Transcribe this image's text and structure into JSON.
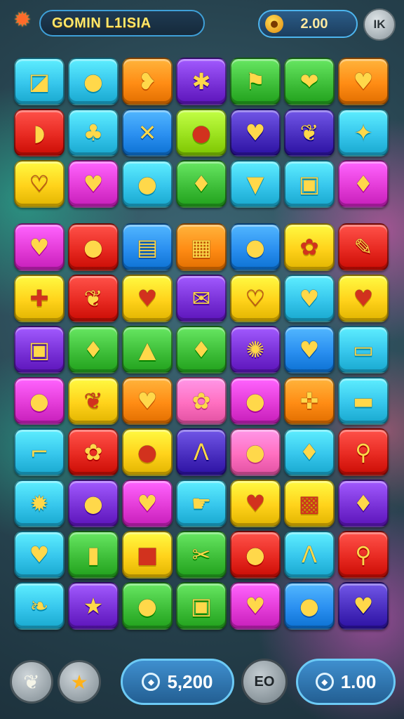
{
  "header": {
    "title": "GOMIN L1ISIA",
    "coins": "2.00",
    "menu_label": "IK",
    "logo_icon": "sun-flower-icon",
    "coin_icon": "coin-icon"
  },
  "colors": {
    "cyan": "#36c6ec",
    "yellow": "#ffd21a",
    "orange": "#ff8c14",
    "purple": "#7a32d8",
    "green": "#3fbf3a",
    "red": "#e82a22",
    "blue": "#2a8ff0",
    "magenta": "#e43cd8",
    "lime": "#9be21e",
    "pink": "#ff6fc0",
    "indigo": "#4a2fc0",
    "teal": "#2ec8b8"
  },
  "board_top": [
    [
      {
        "c": "cyan",
        "i": "◪",
        "n": "envelope-icon"
      },
      {
        "c": "cyan",
        "i": "●",
        "n": "lemon-icon"
      },
      {
        "c": "orange",
        "i": "❥",
        "n": "leaf-heart-icon"
      },
      {
        "c": "purple",
        "i": "✱",
        "n": "bow-icon"
      },
      {
        "c": "green",
        "i": "⚑",
        "n": "flag-icon"
      },
      {
        "c": "green",
        "i": "❤",
        "n": "heart-bubble-icon"
      },
      {
        "c": "orange",
        "i": "♥",
        "n": "heart-icon"
      }
    ],
    [
      {
        "c": "red",
        "i": "◗",
        "n": "half-circle-icon"
      },
      {
        "c": "cyan",
        "i": "♣",
        "n": "puzzle-icon"
      },
      {
        "c": "blue",
        "i": "✕",
        "n": "cross-icon"
      },
      {
        "c": "lime",
        "i": "●",
        "n": "bean-icon"
      },
      {
        "c": "indigo",
        "i": "♥",
        "n": "heart-icon"
      },
      {
        "c": "indigo",
        "i": "❦",
        "n": "chili-icon"
      },
      {
        "c": "cyan",
        "i": "✦",
        "n": "sparkle-icon"
      }
    ],
    [
      {
        "c": "yellow",
        "i": "♡",
        "n": "heart-outline-icon"
      },
      {
        "c": "magenta",
        "i": "♥",
        "n": "heart-icon"
      },
      {
        "c": "cyan",
        "i": "●",
        "n": "orange-fruit-icon"
      },
      {
        "c": "green",
        "i": "♦",
        "n": "strawberry-icon"
      },
      {
        "c": "cyan",
        "i": "▼",
        "n": "carrot-icon"
      },
      {
        "c": "cyan",
        "i": "▣",
        "n": "jar-icon"
      },
      {
        "c": "magenta",
        "i": "♦",
        "n": "eggplant-icon"
      }
    ]
  ],
  "board_bottom": [
    [
      {
        "c": "magenta",
        "i": "♥",
        "n": "heart-icon"
      },
      {
        "c": "red",
        "i": "●",
        "n": "apple-icon"
      },
      {
        "c": "blue",
        "i": "▤",
        "n": "trash-icon"
      },
      {
        "c": "orange",
        "i": "▦",
        "n": "map-icon"
      },
      {
        "c": "blue",
        "i": "●",
        "n": "apple-icon"
      },
      {
        "c": "yellow",
        "i": "✿",
        "n": "flower-icon"
      },
      {
        "c": "red",
        "i": "✎",
        "n": "carrot-icon"
      }
    ],
    [
      {
        "c": "yellow",
        "i": "✚",
        "n": "cross-icon"
      },
      {
        "c": "red",
        "i": "❦",
        "n": "leaf-icon"
      },
      {
        "c": "yellow",
        "i": "♥",
        "n": "heart-icon"
      },
      {
        "c": "purple",
        "i": "✉",
        "n": "ribbon-icon"
      },
      {
        "c": "yellow",
        "i": "♡",
        "n": "heart-outline-icon"
      },
      {
        "c": "cyan",
        "i": "♥",
        "n": "heart-icon"
      },
      {
        "c": "yellow",
        "i": "♥",
        "n": "heart-pin-icon"
      }
    ],
    [
      {
        "c": "purple",
        "i": "▣",
        "n": "camera-icon"
      },
      {
        "c": "green",
        "i": "♦",
        "n": "pepper-icon"
      },
      {
        "c": "green",
        "i": "▲",
        "n": "bell-icon"
      },
      {
        "c": "green",
        "i": "♦",
        "n": "strawberry-icon"
      },
      {
        "c": "purple",
        "i": "✺",
        "n": "flower-icon"
      },
      {
        "c": "blue",
        "i": "♥",
        "n": "heart-icon"
      },
      {
        "c": "cyan",
        "i": "▭",
        "n": "tv-icon"
      }
    ],
    [
      {
        "c": "magenta",
        "i": "●",
        "n": "plum-icon"
      },
      {
        "c": "yellow",
        "i": "❦",
        "n": "leaf-icon"
      },
      {
        "c": "orange",
        "i": "♥",
        "n": "heart-icon"
      },
      {
        "c": "pink",
        "i": "✿",
        "n": "flower-icon"
      },
      {
        "c": "magenta",
        "i": "●",
        "n": "grape-icon"
      },
      {
        "c": "orange",
        "i": "✜",
        "n": "puzzle-icon"
      },
      {
        "c": "cyan",
        "i": "▬",
        "n": "candy-bar-icon"
      }
    ],
    [
      {
        "c": "cyan",
        "i": "⌐",
        "n": "brush-icon"
      },
      {
        "c": "red",
        "i": "✿",
        "n": "flower-icon"
      },
      {
        "c": "yellow",
        "i": "●",
        "n": "badge-icon"
      },
      {
        "c": "indigo",
        "i": "Λ",
        "n": "arch-icon"
      },
      {
        "c": "pink",
        "i": "●",
        "n": "drumstick-icon"
      },
      {
        "c": "cyan",
        "i": "♦",
        "n": "pear-icon"
      },
      {
        "c": "red",
        "i": "⚲",
        "n": "magnifier-icon"
      }
    ],
    [
      {
        "c": "cyan",
        "i": "✹",
        "n": "sun-icon"
      },
      {
        "c": "purple",
        "i": "●",
        "n": "plum-icon"
      },
      {
        "c": "magenta",
        "i": "♥",
        "n": "apple-icon"
      },
      {
        "c": "cyan",
        "i": "☛",
        "n": "hand-icon"
      },
      {
        "c": "yellow",
        "i": "♥",
        "n": "apple-icon"
      },
      {
        "c": "yellow",
        "i": "▩",
        "n": "cake-icon"
      },
      {
        "c": "purple",
        "i": "♦",
        "n": "carrot-icon"
      }
    ],
    [
      {
        "c": "cyan",
        "i": "♥",
        "n": "heart-leaf-icon"
      },
      {
        "c": "green",
        "i": "▮",
        "n": "cup-icon"
      },
      {
        "c": "yellow",
        "i": "■",
        "n": "dice-icon"
      },
      {
        "c": "green",
        "i": "✂",
        "n": "leaf-icon"
      },
      {
        "c": "red",
        "i": "●",
        "n": "apple-icon"
      },
      {
        "c": "cyan",
        "i": "Λ",
        "n": "arch-icon"
      },
      {
        "c": "red",
        "i": "⚲",
        "n": "lollipop-icon"
      }
    ],
    [
      {
        "c": "cyan",
        "i": "❧",
        "n": "leaf-icon"
      },
      {
        "c": "purple",
        "i": "★",
        "n": "star-icon"
      },
      {
        "c": "green",
        "i": "●",
        "n": "apple-icon"
      },
      {
        "c": "green",
        "i": "▣",
        "n": "lock-icon"
      },
      {
        "c": "magenta",
        "i": "♥",
        "n": "heart-icon"
      },
      {
        "c": "blue",
        "i": "●",
        "n": "ring-icon"
      },
      {
        "c": "indigo",
        "i": "♥",
        "n": "heart-icon"
      }
    ]
  ],
  "footer": {
    "left_icon_1": "leaf-icon",
    "left_icon_2": "star-icon",
    "score": "5,200",
    "eo_label": "EO",
    "multiplier": "1.00"
  }
}
